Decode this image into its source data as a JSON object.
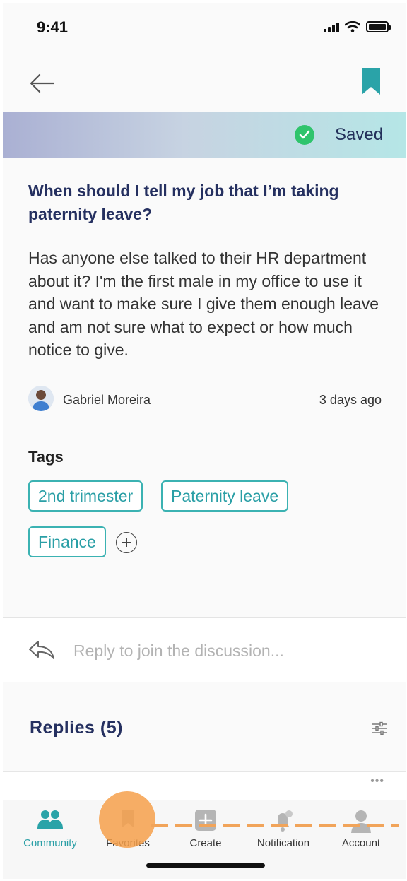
{
  "status_bar": {
    "time": "9:41"
  },
  "saved_banner": {
    "text": "Saved"
  },
  "question": {
    "title": "When should I tell my job that I’m taking paternity leave?",
    "body": "Has anyone else talked to their HR department about it? I'm the first male in my office to use it and want to make sure I give them enough leave and am not sure what to expect or how much notice to give.",
    "author": "Gabriel Moreira",
    "posted": "3 days ago"
  },
  "tags": {
    "heading": "Tags",
    "items": [
      "2nd trimester",
      "Paternity leave",
      "Finance"
    ]
  },
  "reply_input": {
    "placeholder": "Reply to join the discussion..."
  },
  "replies": {
    "heading": "Replies (5)"
  },
  "tab_bar": {
    "items": [
      {
        "label": "Community",
        "icon": "community-icon",
        "active": true
      },
      {
        "label": "Favorites",
        "icon": "bookmark-icon",
        "active": false
      },
      {
        "label": "Create",
        "icon": "plus-square-icon",
        "active": false
      },
      {
        "label": "Notification",
        "icon": "bell-icon",
        "active": false
      },
      {
        "label": "Account",
        "icon": "user-icon",
        "active": false
      }
    ]
  },
  "colors": {
    "accent": "#2a9fa6",
    "title": "#253060",
    "saved_check": "#2fc46c",
    "touch_highlight": "#f6a04b"
  }
}
